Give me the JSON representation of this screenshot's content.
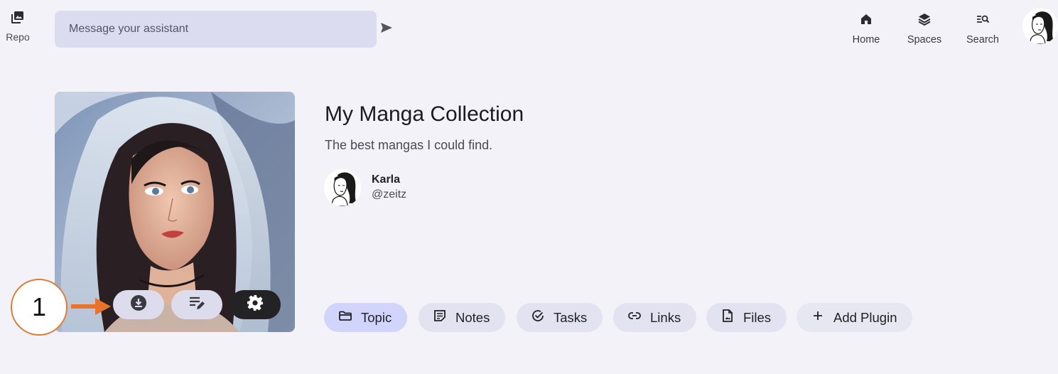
{
  "topbar": {
    "repo_label": "Repo",
    "message_placeholder": "Message your assistant",
    "nav": [
      {
        "label": "Home",
        "icon": "home-icon"
      },
      {
        "label": "Spaces",
        "icon": "layers-icon"
      },
      {
        "label": "Search",
        "icon": "search-list-icon"
      }
    ]
  },
  "collection": {
    "title": "My Manga Collection",
    "description": "The best mangas I could find.",
    "author_name": "Karla",
    "author_handle": "@zeitz"
  },
  "cover_actions": [
    {
      "name": "download",
      "icon": "download-icon"
    },
    {
      "name": "edit",
      "icon": "edit-list-icon"
    },
    {
      "name": "settings",
      "icon": "gear-icon"
    }
  ],
  "annotation": {
    "number": "1",
    "color": "#e07a34"
  },
  "tabs": [
    {
      "label": "Topic",
      "icon": "folder-icon",
      "active": true
    },
    {
      "label": "Notes",
      "icon": "note-icon",
      "active": false
    },
    {
      "label": "Tasks",
      "icon": "check-circle-icon",
      "active": false
    },
    {
      "label": "Links",
      "icon": "link-icon",
      "active": false
    },
    {
      "label": "Files",
      "icon": "file-icon",
      "active": false
    },
    {
      "label": "Add Plugin",
      "icon": "plus-icon",
      "active": false
    }
  ],
  "colors": {
    "background": "#f3f2f9",
    "input_bg": "#dcdcf0",
    "tab_bg": "#e2e2f0",
    "tab_active_bg": "#d2d5fb",
    "settings_btn_bg": "#232326",
    "annotation": "#e07a34"
  }
}
